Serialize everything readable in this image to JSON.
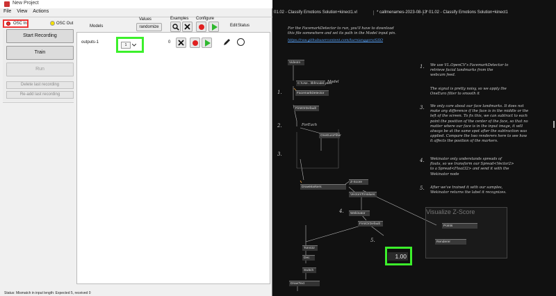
{
  "wekinator": {
    "title": "New Project",
    "menu": [
      "File",
      "View",
      "Actions"
    ],
    "osc_in_label": "OSC In",
    "osc_out_label": "OSC Out",
    "values_label": "Values",
    "randomize_label": "randomize",
    "examples_label": "Examples",
    "configure_label": "Configure",
    "models_label": "Models",
    "edit_label": "Edit",
    "status_label": "Status",
    "start_recording": "Start Recording",
    "train": "Train",
    "run": "Run",
    "delete_last": "Delete last recording",
    "readd_last": "Re-add last recording",
    "model_row": {
      "name": "outputs-1",
      "dropdown_value": "1",
      "example_count": "0"
    },
    "status_bar": "Status:  Mismatch in input length: Expected 5, received 0",
    "colors": {
      "osc_in": "#e33333",
      "osc_out": "#f5e000",
      "highlight": "#3cf02b",
      "record": "#e02020",
      "play": "#2eb82e"
    }
  },
  "patch": {
    "tabs": [
      "01.02 - Classify Emotions Solution+kinect1.vl",
      "* callmenames-2023-08-13",
      "* 01.02 - Classify Emotions Solution+kinect1"
    ],
    "intro_note": [
      "For the FacemarkDetector to run, you'll have to download",
      "this file somewhere and set its path in the Model input pin."
    ],
    "intro_link": "https://raw.githubusercontent.com/kurnianggoro/GSO",
    "nodes": {
      "videoin": "VideoIn",
      "model_path": "C:\\Use...\\lbfmodel.yaml",
      "model_pin": "Model",
      "facemark": "FacemarkDetector",
      "firstordefault1": "FirstOrDefault",
      "foreach": "ForEach",
      "oneeuro": "OneEuroFilter",
      "drawmarkers": "DrawMarkers",
      "zscore": "Z-Score",
      "vectorstovalues": "VectorsToValues",
      "wekinator": "Wekinator",
      "firstordefault2": "FirstOrDefault",
      "tobit32": "ToInt32",
      "dec": "Dec",
      "switch": "Switch",
      "drawtext": "DrawText",
      "points": "Points",
      "renderer": "Renderer"
    },
    "step_numbers": [
      "1.",
      "2.",
      "3.",
      "4.",
      "5."
    ],
    "notes": [
      {
        "num": "1.",
        "lines": [
          "We use VL.OpenCV's FacemarkDetector to",
          "retrieve facial landmarks from the",
          "webcam feed."
        ]
      },
      {
        "num": "",
        "lines": [
          "The signal is pretty noisy, so we apply the",
          "OneEuro filter to smooth it"
        ]
      },
      {
        "num": "3.",
        "lines": [
          "We only care about our face landmarks. It does not",
          "make any difference if the face is in the middle or the",
          "left of the screen. To fix this, we can subtract to each",
          "point the position of the center of the face, so that no",
          "matter where our face is in the input image, it will",
          "always be at the same spot after the subtraction was",
          "applied. Compare the two renderers here to see how",
          "it affects the position of the markers."
        ]
      },
      {
        "num": "4.",
        "lines": [
          "Wekinator only understands spreads of",
          "floats, so we transform our Spread<Vector2>",
          "to a Spread<Float32> and send it with the",
          "Wekinator node"
        ]
      },
      {
        "num": "5.",
        "lines": [
          "After we've trained it with our samples,",
          "Wekinator returns the label it recognizes."
        ]
      }
    ],
    "visualize_title": "Visualize Z-Score",
    "output_value": "1.00"
  }
}
